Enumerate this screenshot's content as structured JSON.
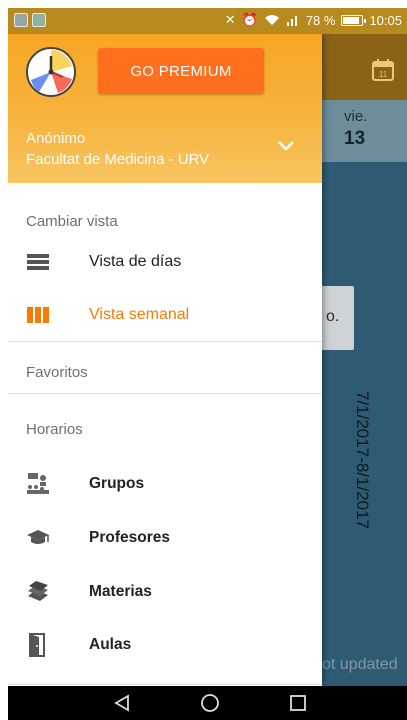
{
  "status_bar": {
    "battery": "78 %",
    "time": "10:05",
    "battery_level": 0.78
  },
  "background": {
    "day_name": "vie.",
    "day_number": "13",
    "card_text": "o.",
    "date_range": "7/1/2017-8/1/2017",
    "status_text": "ot updated",
    "calendar_icon_number": "11"
  },
  "drawer": {
    "premium_button": "GO PREMIUM",
    "user_name": "Anónimo",
    "user_org": "Facultat de Medicina - URV",
    "section_view": "Cambiar vista",
    "view_items": [
      {
        "label": "Vista de días",
        "icon": "day-view-icon"
      },
      {
        "label": "Vista semanal",
        "icon": "week-view-icon",
        "active": true
      }
    ],
    "section_favorites": "Favoritos",
    "section_schedules": "Horarios",
    "schedule_items": [
      {
        "label": "Grupos",
        "icon": "groups-icon"
      },
      {
        "label": "Profesores",
        "icon": "graduation-cap-icon"
      },
      {
        "label": "Materias",
        "icon": "books-icon"
      },
      {
        "label": "Aulas",
        "icon": "door-icon"
      }
    ]
  },
  "colors": {
    "header_orange": "#f7a624",
    "premium_orange": "#ff6f1e",
    "active_orange": "#f57c00",
    "background_teal": "#2e5b73"
  }
}
